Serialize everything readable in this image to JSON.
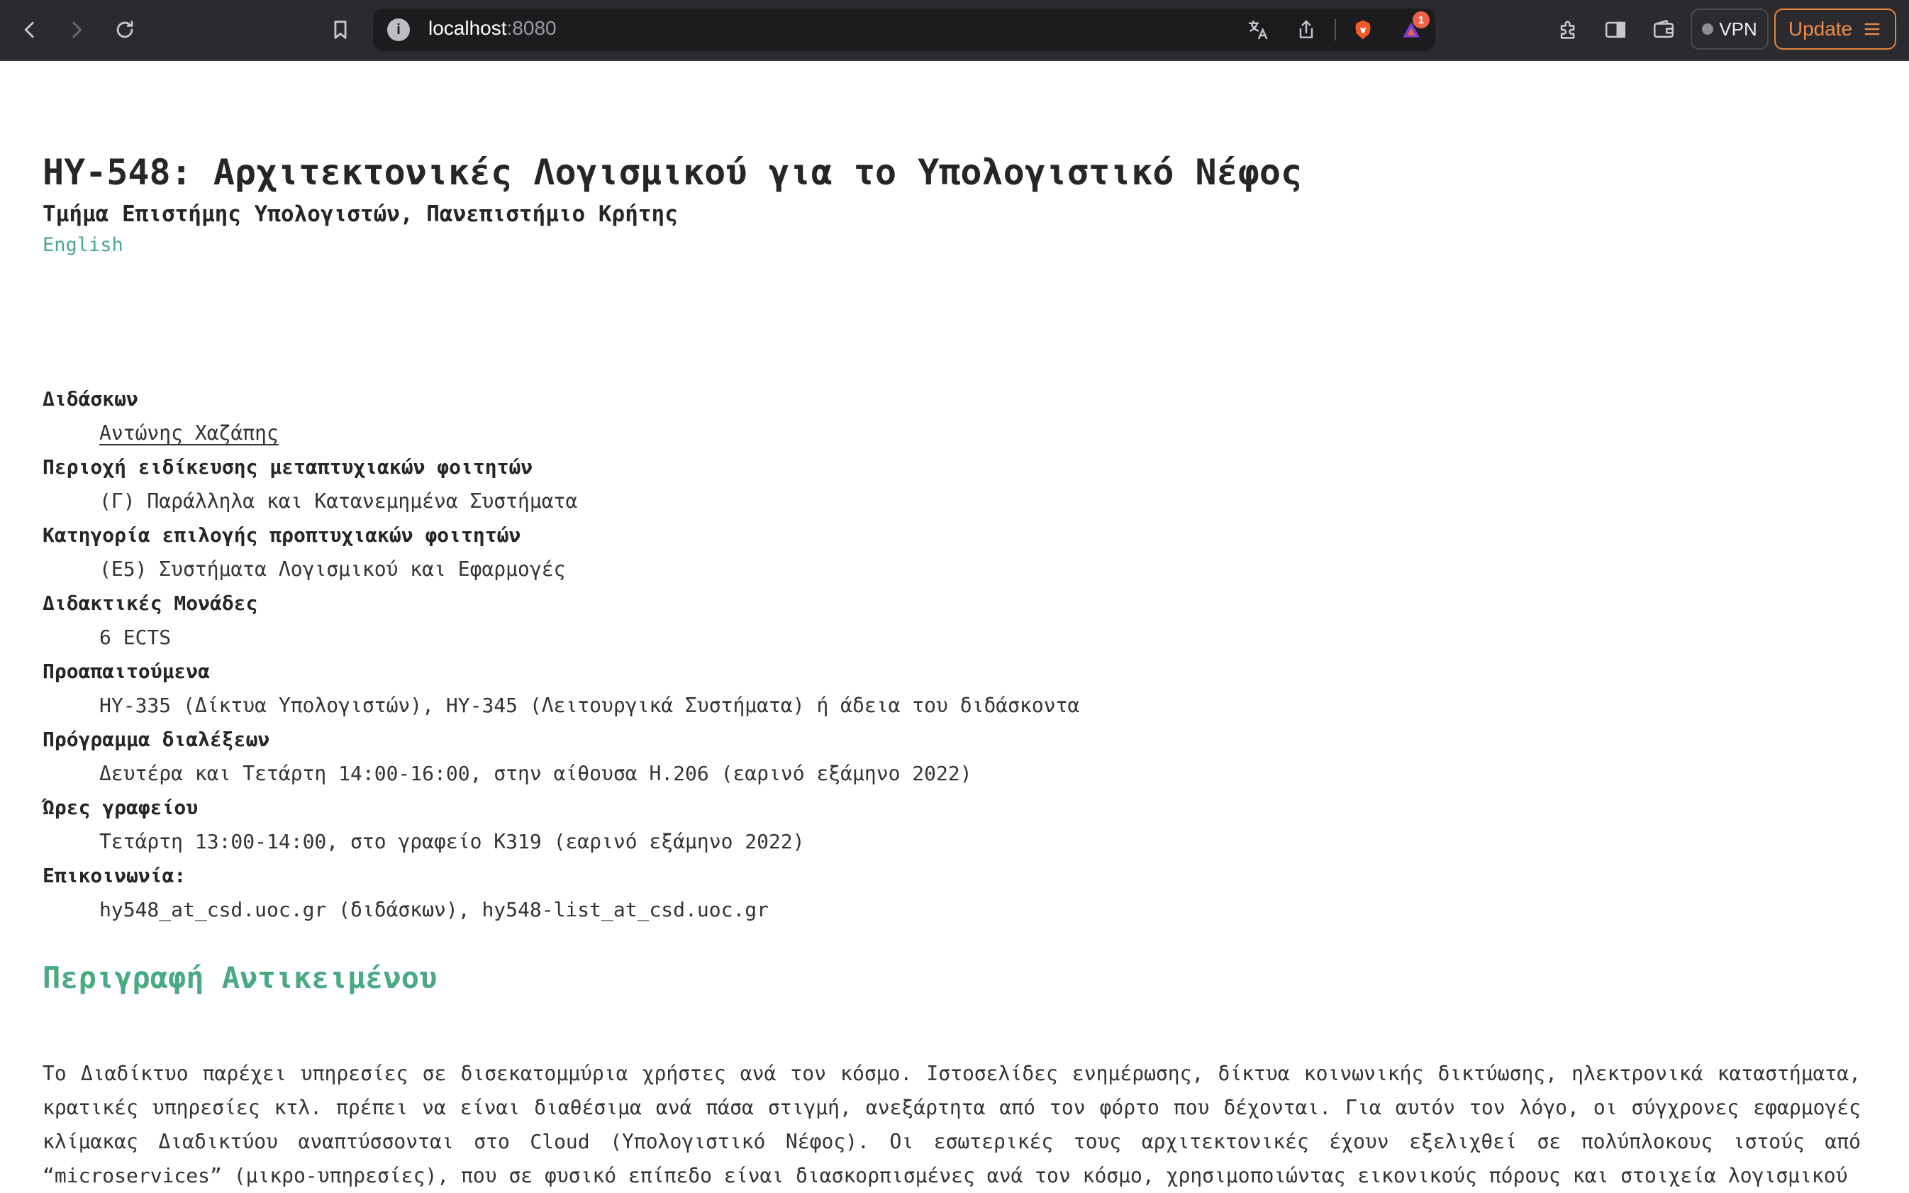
{
  "browser": {
    "url_host": "localhost",
    "url_port": ":8080",
    "shields_badge": "1",
    "vpn_label": "VPN",
    "update_label": "Update"
  },
  "page": {
    "title": "HY-548: Αρχιτεκτονικές Λογισμικού για το Υπολογιστικό Νέφος",
    "subtitle": "Τμήμα Επιστήμης Υπολογιστών, Πανεπιστήμιο Κρήτης",
    "language_link": "English",
    "info": [
      {
        "term": "Διδάσκων",
        "value": "Αντώνης Χαζάπης"
      },
      {
        "term": "Περιοχή ειδίκευσης μεταπτυχιακών φοιτητών",
        "value": "(Γ) Παράλληλα και Κατανεμημένα Συστήματα"
      },
      {
        "term": "Κατηγορία επιλογής προπτυχιακών φοιτητών",
        "value": "(Ε5) Συστήματα Λογισμικού και Εφαρμογές"
      },
      {
        "term": "Διδακτικές Μονάδες",
        "value": "6 ECTS"
      },
      {
        "term": "Προαπαιτούμενα",
        "value": "HY-335 (Δίκτυα Υπολογιστών), HY-345 (Λειτουργικά Συστήματα) ή άδεια του διδάσκοντα"
      },
      {
        "term": "Πρόγραμμα διαλέξεων",
        "value": "Δευτέρα και Τετάρτη 14:00-16:00, στην αίθουσα Η.206 (εαρινό εξάμηνο 2022)"
      },
      {
        "term": "Ώρες γραφείου",
        "value": "Τετάρτη 13:00-14:00, στο γραφείο Κ319 (εαρινό εξάμηνο 2022)"
      },
      {
        "term": "Επικοινωνία:",
        "value": "hy548_at_csd.uoc.gr (διδάσκων), hy548-list_at_csd.uoc.gr"
      }
    ],
    "section_title": "Περιγραφή Αντικειμένου",
    "description": "Το Διαδίκτυο παρέχει υπηρεσίες σε δισεκατομμύρια χρήστες ανά τον κόσμο. Ιστοσελίδες ενημέρωσης, δίκτυα κοινωνικής δικτύωσης, ηλεκτρονικά καταστήματα, κρατικές υπηρεσίες κτλ. πρέπει να είναι διαθέσιμα ανά πάσα στιγμή, ανεξάρτητα από τον φόρτο που δέχονται. Για αυτόν τον λόγο, οι σύγχρονες εφαρμογές κλίμακας Διαδικτύου αναπτύσσονται στο Cloud (Υπολογιστικό Νέφος). Οι εσωτερικές τους αρχιτεκτονικές έχουν εξελιχθεί σε πολύπλοκους ιστούς από “microservices” (μικρο-υπηρεσίες), που σε φυσικό επίπεδο είναι διασκορπισμένες ανά τον κόσμο, χρησιμοποιώντας εικονικούς πόρους και στοιχεία λογισμικού"
  }
}
